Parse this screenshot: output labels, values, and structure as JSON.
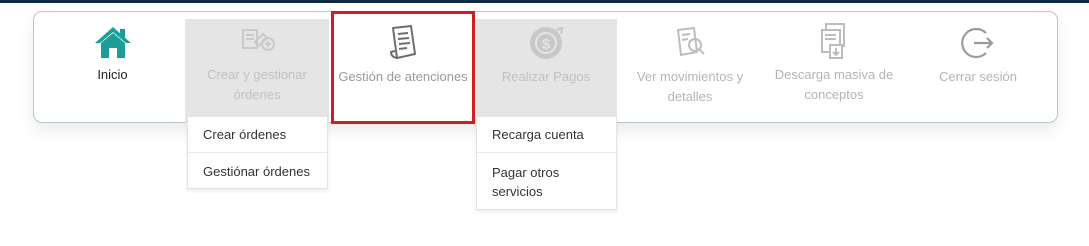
{
  "nav": {
    "items": [
      {
        "label": "Inicio",
        "icon": "home-icon"
      },
      {
        "label": "Crear y gestionar órdenes",
        "icon": "orders-icon"
      },
      {
        "label": "Gestión de atenciones",
        "icon": "document-icon"
      },
      {
        "label": "Realizar Pagos",
        "icon": "payment-icon"
      },
      {
        "label": "Ver movimientos y detalles",
        "icon": "search-document-icon"
      },
      {
        "label": "Descarga masiva de conceptos",
        "icon": "download-document-icon"
      },
      {
        "label": "Cerrar sesión",
        "icon": "logout-icon"
      }
    ]
  },
  "orders_menu": {
    "items": [
      "Crear órdenes",
      "Gestiónar órdenes"
    ]
  },
  "payments_menu": {
    "items": [
      "Recarga cuenta",
      "Pagar otros servicios"
    ]
  },
  "colors": {
    "accent": "#1a9e97",
    "highlight": "#cf1f25",
    "hover_bg": "#e5e5e5"
  }
}
